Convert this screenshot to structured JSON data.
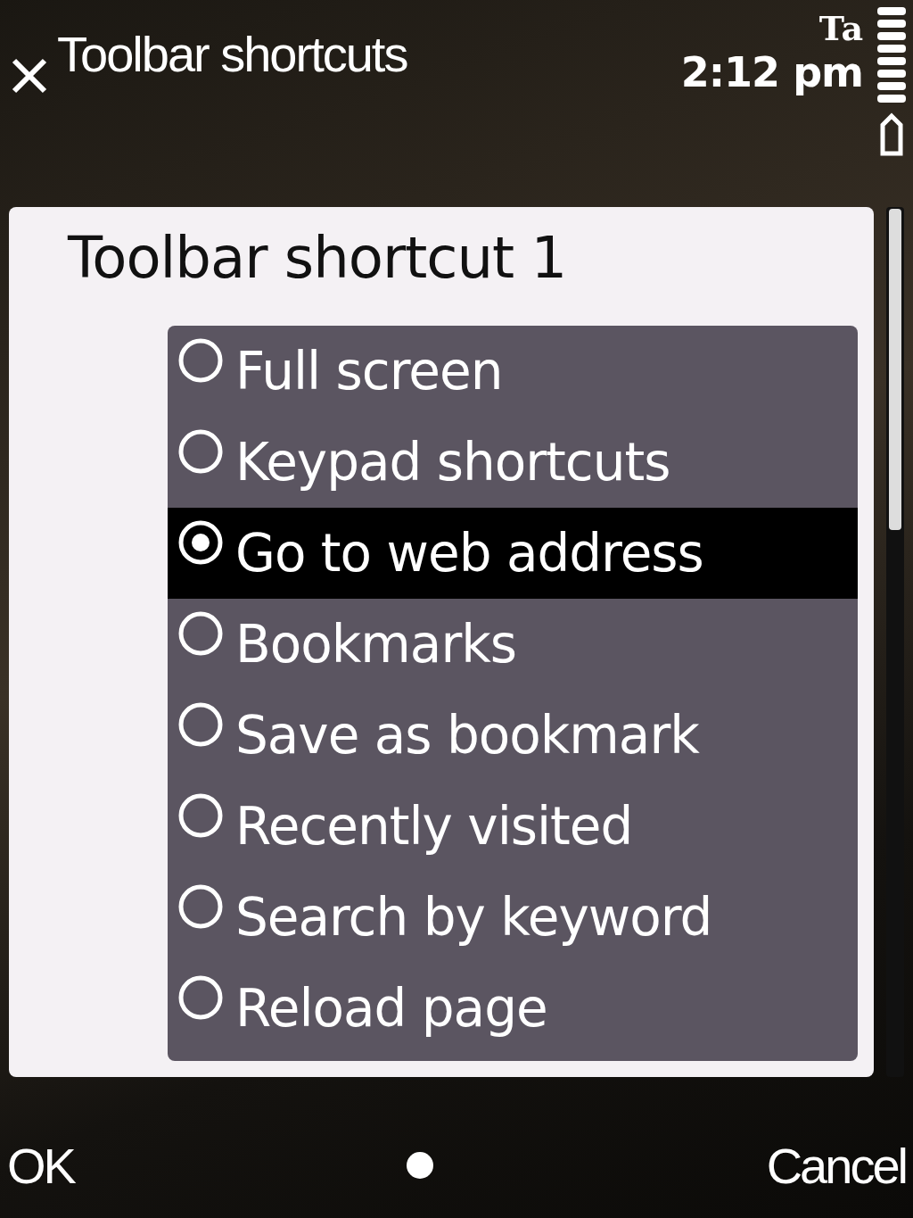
{
  "title_bar": {
    "title": "Toolbar shortcuts",
    "input_indicator": "Ta",
    "time": "2:12 pm"
  },
  "dialog": {
    "heading": "Toolbar shortcut 1",
    "options": [
      {
        "label": "Full screen",
        "selected": false
      },
      {
        "label": "Keypad shortcuts",
        "selected": false
      },
      {
        "label": "Go to web address",
        "selected": true
      },
      {
        "label": "Bookmarks",
        "selected": false
      },
      {
        "label": "Save as bookmark",
        "selected": false
      },
      {
        "label": "Recently visited",
        "selected": false
      },
      {
        "label": "Search by keyword",
        "selected": false
      },
      {
        "label": "Reload page",
        "selected": false
      }
    ]
  },
  "softkeys": {
    "left": "OK",
    "right": "Cancel"
  }
}
